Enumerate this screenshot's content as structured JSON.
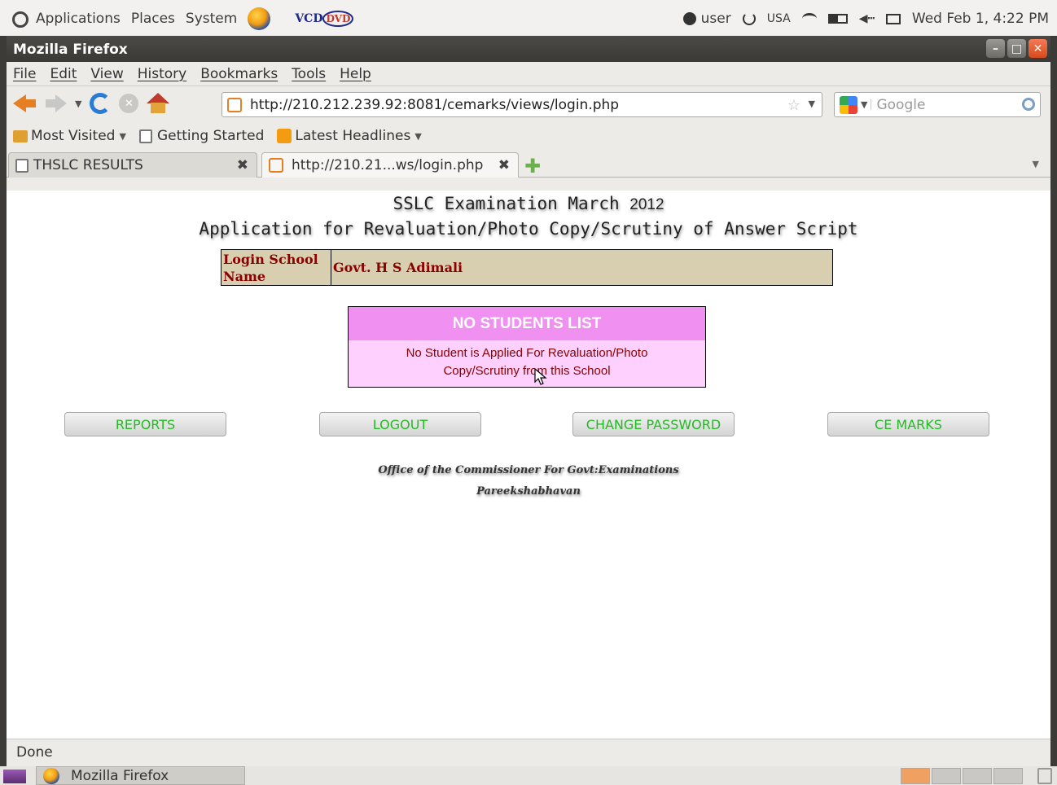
{
  "top_panel": {
    "menus": [
      "Applications",
      "Places",
      "System"
    ],
    "vcd_logo": "VCD",
    "dvd_logo": "DVD",
    "user": "user",
    "keyboard_layout": "USA",
    "datetime": "Wed Feb 1, 4:22 PM"
  },
  "window": {
    "title": "Mozilla Firefox",
    "menu": [
      "File",
      "Edit",
      "View",
      "History",
      "Bookmarks",
      "Tools",
      "Help"
    ],
    "url": "http://210.212.239.92:8081/cemarks/views/login.php",
    "search_placeholder": "Google",
    "bookmarks": [
      "Most Visited",
      "Getting Started",
      "Latest Headlines"
    ],
    "tabs": [
      {
        "label": "THSLC RESULTS"
      },
      {
        "label": "http://210.21...ws/login.php"
      }
    ],
    "status": "Done"
  },
  "page": {
    "heading_line1": "SSLC Examination March",
    "heading_year": "2012",
    "heading_line2": "Application for Revaluation/Photo Copy/Scrutiny of Answer Script",
    "login_label": "Login School Name",
    "school_name": "Govt. H S Adimali",
    "notice_title": "NO STUDENTS LIST",
    "notice_line1": "No Student is Applied For Revaluation/Photo",
    "notice_line2": "Copy/Scrutiny from this School",
    "buttons": {
      "reports": "REPORTS",
      "logout": "LOGOUT",
      "change_password": "CHANGE PASSWORD",
      "ce_marks": "CE MARKS"
    },
    "footer_line1": "Office of the Commissioner For Govt:Examinations",
    "footer_line2": "Pareekshabhavan"
  },
  "taskbar": {
    "task_label": "Mozilla Firefox"
  }
}
